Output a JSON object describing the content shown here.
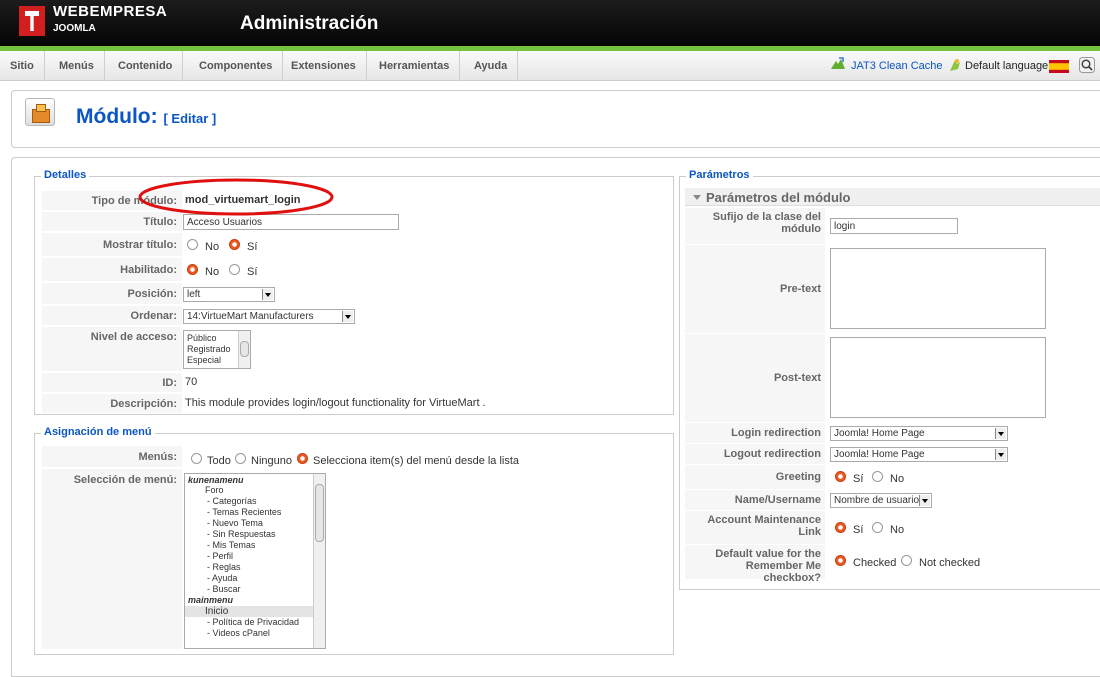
{
  "header": {
    "brand": "WEBEMPRESA",
    "brand_sub": "JOOMLA",
    "title": "Administración"
  },
  "menu": {
    "items": [
      "Sitio",
      "Menús",
      "Contenido",
      "Componentes",
      "Extensiones",
      "Herramientas",
      "Ayuda"
    ],
    "jat3": "JAT3 Clean Cache",
    "default_language": "Default language:"
  },
  "page": {
    "title": "Módulo:",
    "subtitle": "[ Editar ]"
  },
  "detalles": {
    "legend": "Detalles",
    "tipo_label": "Tipo de módulo:",
    "tipo_value": "mod_virtuemart_login",
    "titulo_label": "Título:",
    "titulo_value": "Acceso Usuarios",
    "mostrar_label": "Mostrar título:",
    "mostrar_no": "No",
    "mostrar_si": "Sí",
    "habilitado_label": "Habilitado:",
    "habilitado_no": "No",
    "habilitado_si": "Sí",
    "posicion_label": "Posición:",
    "posicion_value": "left",
    "ordenar_label": "Ordenar:",
    "ordenar_value": "14:VirtueMart Manufacturers",
    "nivel_label": "Nivel de acceso:",
    "nivel_options": [
      "Público",
      "Registrado",
      "Especial"
    ],
    "id_label": "ID:",
    "id_value": "70",
    "desc_label": "Descripción:",
    "desc_value": "This module provides login/logout functionality for VirtueMart ."
  },
  "asignacion": {
    "legend": "Asignación de menú",
    "menus_label": "Menús:",
    "opt_todo": "Todo",
    "opt_ninguno": "Ninguno",
    "opt_selecciona": "Selecciona item(s) del menú desde la lista",
    "seleccion_label": "Selección de menú:",
    "list_items": [
      "kunenamenu",
      "Foro",
      "- Categorías",
      "- Temas Recientes",
      "- Nuevo Tema",
      "- Sin Respuestas",
      "- Mis Temas",
      "- Perfil",
      "- Reglas",
      "- Ayuda",
      "- Buscar",
      "mainmenu",
      "Inicio",
      "- Política de Privacidad",
      "- Videos cPanel"
    ]
  },
  "parametros": {
    "legend": "Parámetros",
    "section_title": "Parámetros del módulo",
    "sufijo_label": "Sufijo de la clase del módulo",
    "sufijo_value": "login",
    "pretext_label": "Pre-text",
    "posttext_label": "Post-text",
    "login_label": "Login redirection",
    "login_value": "Joomla! Home Page",
    "logout_label": "Logout redirection",
    "logout_value": "Joomla! Home Page",
    "greeting_label": "Greeting",
    "greeting_si": "Sí",
    "greeting_no": "No",
    "name_label": "Name/Username",
    "name_value": "Nombre de usuario",
    "account_label": "Account Maintenance Link",
    "account_si": "Sí",
    "account_no": "No",
    "remember_label": "Default value for the Remember Me checkbox?",
    "remember_checked": "Checked",
    "remember_not": "Not checked"
  },
  "colors": {
    "accent": "#0b55c4",
    "green_bar": "#74c23e",
    "logo_red": "#d11f1f",
    "annotation_red": "#e01010"
  }
}
